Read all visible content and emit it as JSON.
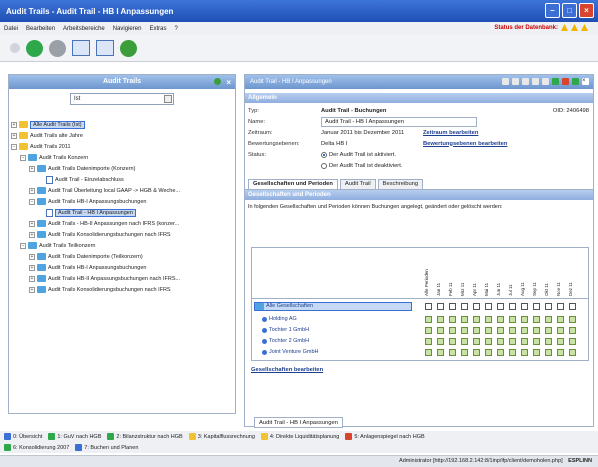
{
  "window": {
    "title": "Audit Trails - Audit Trail - HB I Anpassungen"
  },
  "menu": {
    "items": [
      "Datei",
      "Bearbeiten",
      "Arbeitsbereiche",
      "Navigieren",
      "Extras",
      "?"
    ],
    "db_status": "Status der Datenbank:"
  },
  "left": {
    "header": "Audit Trails",
    "filter_value": "Ist",
    "tree": [
      {
        "label": "Alle Audit Trails (Ist)",
        "level": 0,
        "icon": "folder",
        "selected": true
      },
      {
        "label": "Audit Trails alte Jahre",
        "level": 0,
        "icon": "folder"
      },
      {
        "label": "Audit Trails 2011",
        "level": 0,
        "icon": "folder"
      },
      {
        "label": "Audit Trails Konzern",
        "level": 1,
        "icon": "folder-blue"
      },
      {
        "label": "Audit Trails Datenimporte (Konzern)",
        "level": 2,
        "icon": "folder-blue"
      },
      {
        "label": "Audit Trail - Einzelabschluss",
        "level": 3,
        "icon": "doc"
      },
      {
        "label": "Audit Trail Überleitung local GAAP -> HGB & Weche...",
        "level": 2,
        "icon": "folder-blue"
      },
      {
        "label": "Audit Trails HB-I Anpassungsbuchungen",
        "level": 2,
        "icon": "folder-blue"
      },
      {
        "label": "Audit Trail - HB I Anpassungen",
        "level": 3,
        "icon": "doc",
        "selected": true
      },
      {
        "label": "Audit Trails - HB-II Anpassungen nach IFRS (konzer...",
        "level": 2,
        "icon": "folder-blue"
      },
      {
        "label": "Audit Trails Konsolidierungsbuchungen nach IFRS",
        "level": 2,
        "icon": "folder-blue"
      },
      {
        "label": "Audit Trails Teilkonzern",
        "level": 1,
        "icon": "folder-blue"
      },
      {
        "label": "Audit Trails Datenimporte (Teilkonzern)",
        "level": 2,
        "icon": "folder-blue"
      },
      {
        "label": "Audit Trails HB-I Anpassungsbuchungen",
        "level": 2,
        "icon": "folder-blue"
      },
      {
        "label": "Audit Trails HB-II Anpassungsbuchungen nach IFRS...",
        "level": 2,
        "icon": "folder-blue"
      },
      {
        "label": "Audit Trails Konsolidierungsbuchungen nach IFRS",
        "level": 2,
        "icon": "folder-blue"
      }
    ]
  },
  "right": {
    "header": "Audit Trail - HB I Anpassungen",
    "section_general": "Allgemein",
    "typ_label": "Typ:",
    "typ_value": "Audit Trail - Buchungen",
    "oid": "OID: 2406498",
    "name_label": "Name:",
    "name_value": "Audit Trail - HB I Anpassungen",
    "zeitraum_label": "Zeitraum:",
    "zeitraum_value": "Januar 2011 bis Dezember 2011",
    "zeitraum_link": "Zeitraum bearbeiten",
    "bew_label": "Bewertungsebenen:",
    "bew_value": "Delta HB I",
    "bew_link": "Bewertungsebenen bearbeiten",
    "status_label": "Status:",
    "status_active": "Der Audit Trail ist aktiviert.",
    "status_inactive": "Der Audit Trail ist deaktiviert.",
    "tabs": [
      "Gesellschaften und Perioden",
      "Audit Trail",
      "Beschreibung"
    ],
    "section_companies": "Gesellschaften und Perioden",
    "info_text": "In folgenden Gesellschaften und Perioden können Buchungen angelegt, geändert oder gelöscht werden:",
    "periods": [
      "Alle Perioden",
      "Jan 11",
      "Feb 11",
      "Mrz 11",
      "Apr 11",
      "Mai 11",
      "Jun 11",
      "Jul 11",
      "Aug 11",
      "Sep 11",
      "Okt 11",
      "Nov 11",
      "Dez 11"
    ],
    "all_companies": "Alle Gesellschaften",
    "companies": [
      "Holding AG",
      "Tochter 1 GmbH",
      "Tochter 2 GmbH",
      "Joint Venture GmbH"
    ],
    "companies_link": "Gesellschaften bearbeiten",
    "bottom_tab": "Audit Trail - HB I Anpassungen"
  },
  "footer": {
    "items": [
      "0: Übersicht",
      "1: GuV nach HGB",
      "2: Bilanzstruktur nach HGB",
      "3: Kapitalflussrechnung",
      "4: Direkte Liquiditätsplanung",
      "5: Anlagenspiegel nach HGB",
      "6: Konsolidierung 2007",
      "7: Buchen und Planen"
    ]
  },
  "statusbar": {
    "text": "Administrator [http://192.168.2.142:8/1inp/ifp/client/demoholen.php]",
    "badge": "ESPLINN"
  }
}
